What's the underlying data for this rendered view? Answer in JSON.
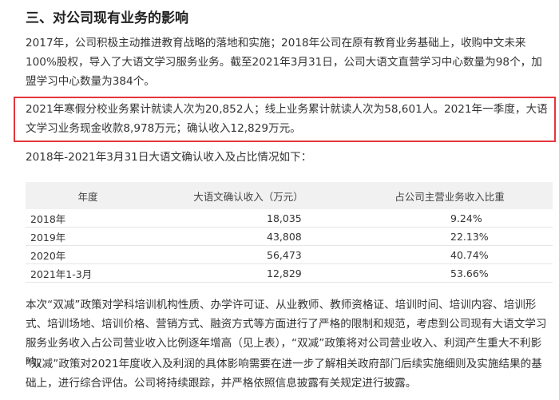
{
  "heading": "三、对公司现有业务的影响",
  "paragraphs": {
    "p1": "2017年，公司积极主动推进教育战略的落地和实施；2018年公司在原有教育业务基础上，收购中文未来100%股权，导入了大语文学习服务业务。截至2021年3月31日，公司大语文直营学习中心数量为98个，加盟学习中心数量为384个。",
    "p2": "2021年寒假分校业务累计就读人次为20,852人；线上业务累计就读人次为58,601人。2021年一季度，大语文学习业务现金收款8,978万元；确认收入12,829万元。",
    "p3": "2018年-2021年3月31日大语文确认收入及占比情况如下：",
    "p4": "本次“双减”政策对学科培训机构性质、办学许可证、从业教师、教师资格证、培训时间、培训内容、培训形式、培训场地、培训价格、营销方式、融资方式等方面进行了严格的限制和规范，考虑到公司现有大语文学习服务业务收入占公司营业收入比例逐年增高（见上表），“双减”政策将对公司营业收入、利润产生重大不利影响。",
    "p5": "“双减”政策对2021年度收入及利润的具体影响需要在进一步了解相关政府部门后续实施细则及实施结果的基础上，进行综合评估。公司将持续跟踪，并严格依照信息披露有关规定进行披露。"
  },
  "table": {
    "headers": [
      "年度",
      "大语文确认收入（万元）",
      "占公司主营业务收入比重"
    ],
    "rows": [
      {
        "year": "2018年",
        "revenue": "18,035",
        "share": "9.24%"
      },
      {
        "year": "2019年",
        "revenue": "43,808",
        "share": "22.13%"
      },
      {
        "year": "2020年",
        "revenue": "56,473",
        "share": "40.74%"
      },
      {
        "year": "2021年1-3月",
        "revenue": "12,829",
        "share": "53.66%"
      }
    ]
  },
  "colors": {
    "highlight_border": "#e3363c",
    "table_header_bg": "#f1f1f1"
  }
}
